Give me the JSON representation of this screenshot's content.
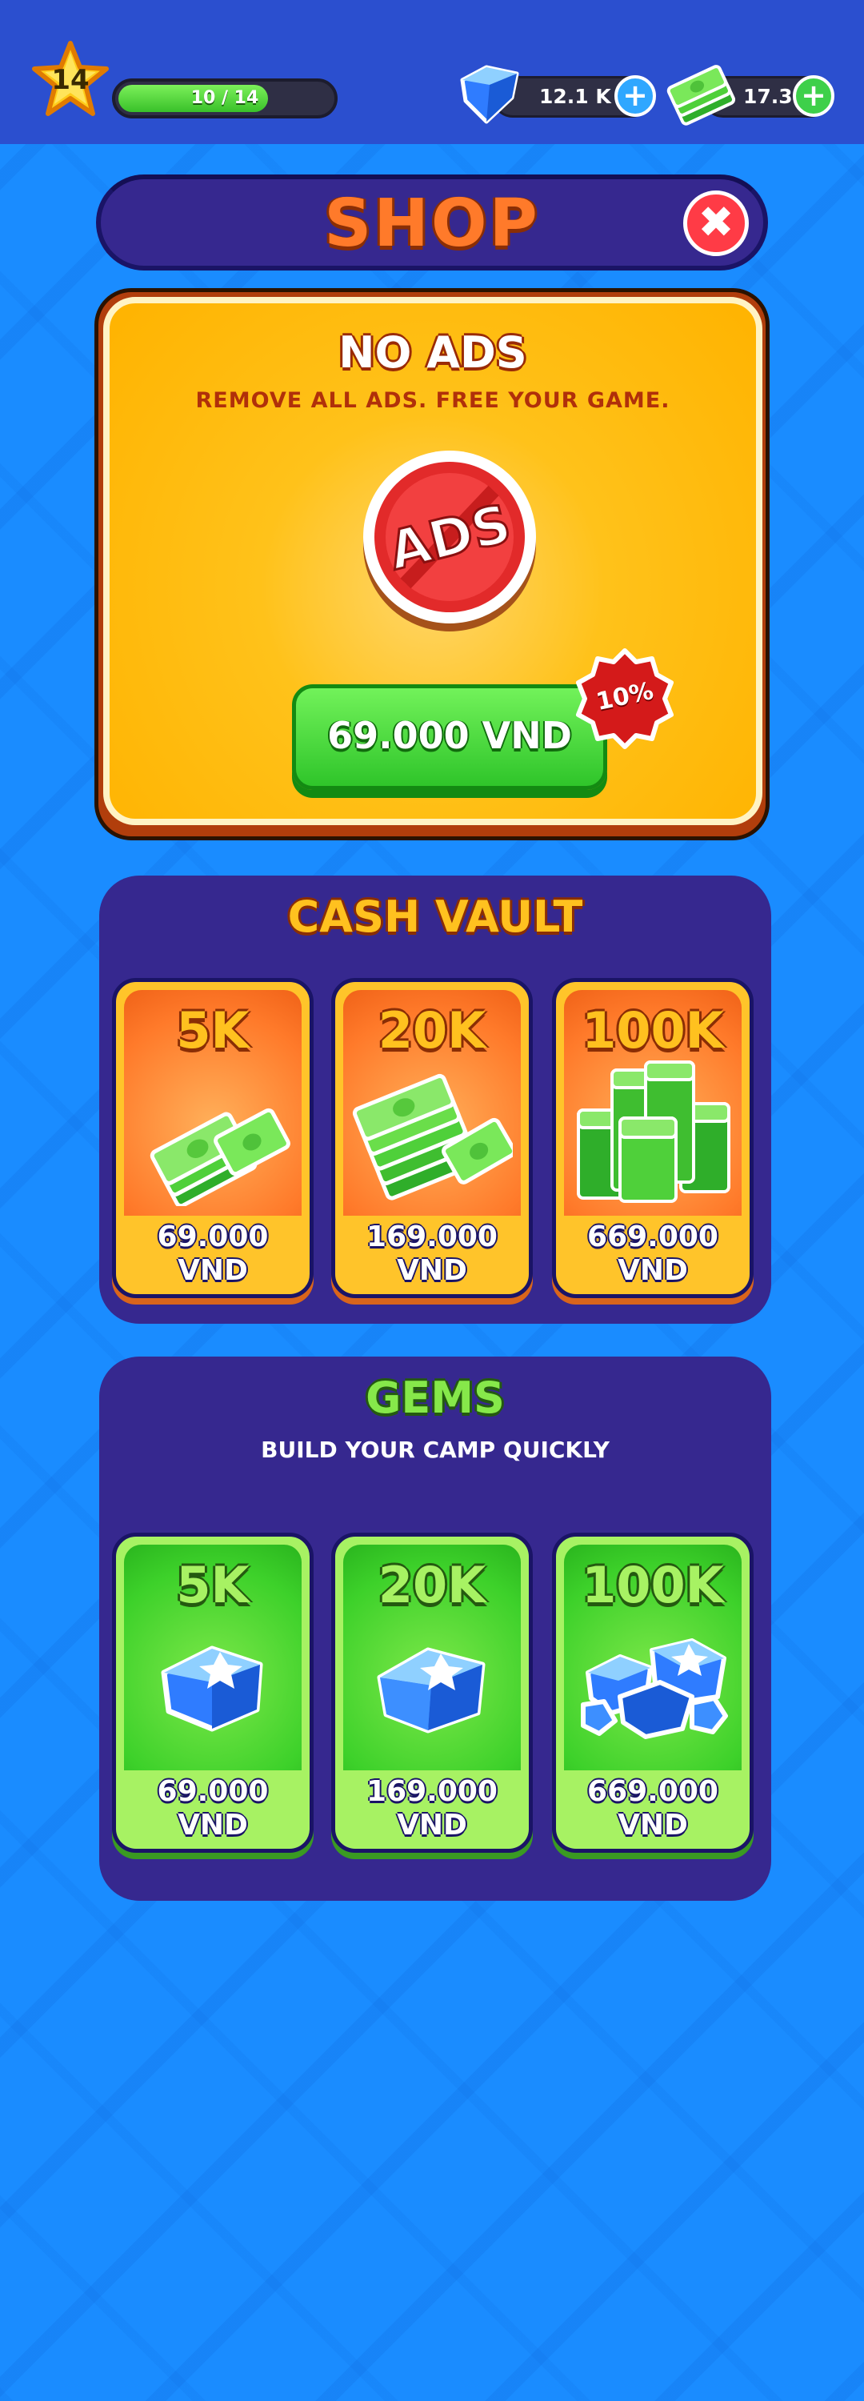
{
  "hud": {
    "level": "14",
    "xp_text": "10 / 14",
    "xp_progress": 0.71,
    "gems_amount": "12.1 K",
    "cash_amount": "17.3 K",
    "plus_symbol": "+"
  },
  "shop": {
    "title": "SHOP",
    "close_symbol": "✖"
  },
  "no_ads": {
    "title": "NO ADS",
    "subtitle": "REMOVE ALL ADS. FREE YOUR GAME.",
    "icon_label": "ADS",
    "price": "69.000 VND",
    "discount": "10%"
  },
  "cash_vault": {
    "title": "CASH VAULT",
    "items": [
      {
        "amount": "5K",
        "price_line1": "69.000",
        "price_line2": "VND",
        "icon": "cash-small-icon"
      },
      {
        "amount": "20K",
        "price_line1": "169.000",
        "price_line2": "VND",
        "icon": "cash-medium-icon"
      },
      {
        "amount": "100K",
        "price_line1": "669.000",
        "price_line2": "VND",
        "icon": "cash-large-icon"
      }
    ]
  },
  "gems": {
    "title": "GEMS",
    "subtitle": "BUILD YOUR CAMP QUICKLY",
    "items": [
      {
        "amount": "5K",
        "price_line1": "69.000",
        "price_line2": "VND",
        "icon": "gem-small-icon"
      },
      {
        "amount": "20K",
        "price_line1": "169.000",
        "price_line2": "VND",
        "icon": "gem-medium-icon"
      },
      {
        "amount": "100K",
        "price_line1": "669.000",
        "price_line2": "VND",
        "icon": "gem-large-icon"
      }
    ]
  },
  "colors": {
    "background": "#1a8cff",
    "topbar": "#2b4fcf",
    "panel": "#36288f",
    "shop_title": "#ff7a2a",
    "green_button": "#2fc52a",
    "close_red": "#ff3b46"
  }
}
